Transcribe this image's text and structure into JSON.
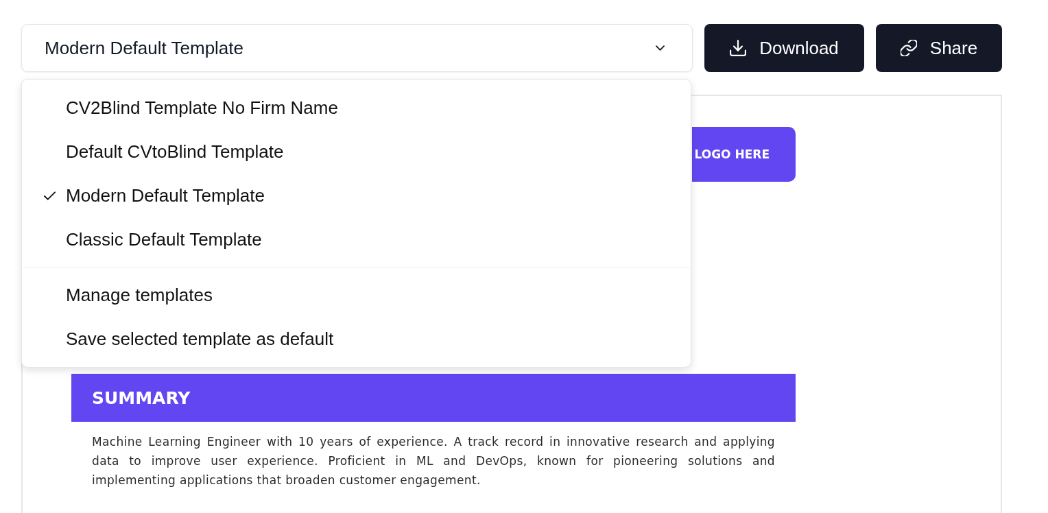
{
  "template_select": {
    "value": "Modern Default Template",
    "expanded": true
  },
  "buttons": [
    {
      "kind": "download",
      "label": "Download"
    },
    {
      "kind": "share",
      "label": "Share"
    }
  ],
  "dropdown": {
    "groups": [
      {
        "items": [
          {
            "label": "CV2Blind Template No Firm Name",
            "selected": false
          },
          {
            "label": "Default CVtoBlind Template",
            "selected": false
          },
          {
            "label": "Modern Default Template",
            "selected": true
          },
          {
            "label": "Classic Default Template",
            "selected": false
          }
        ]
      },
      {
        "items": [
          {
            "label": "Manage templates"
          },
          {
            "label": "Save selected template as default"
          }
        ]
      }
    ]
  },
  "document": {
    "logo_placeholder": "LOGO HERE",
    "sections": [
      {
        "heading": "SUMMARY",
        "body": "Machine Learning Engineer with 10 years of experience. A track record in innovative research and applying data to improve user experience. Proficient in ML and DevOps, known for pioneering solutions and implementing applications that broaden customer engagement."
      }
    ]
  }
}
